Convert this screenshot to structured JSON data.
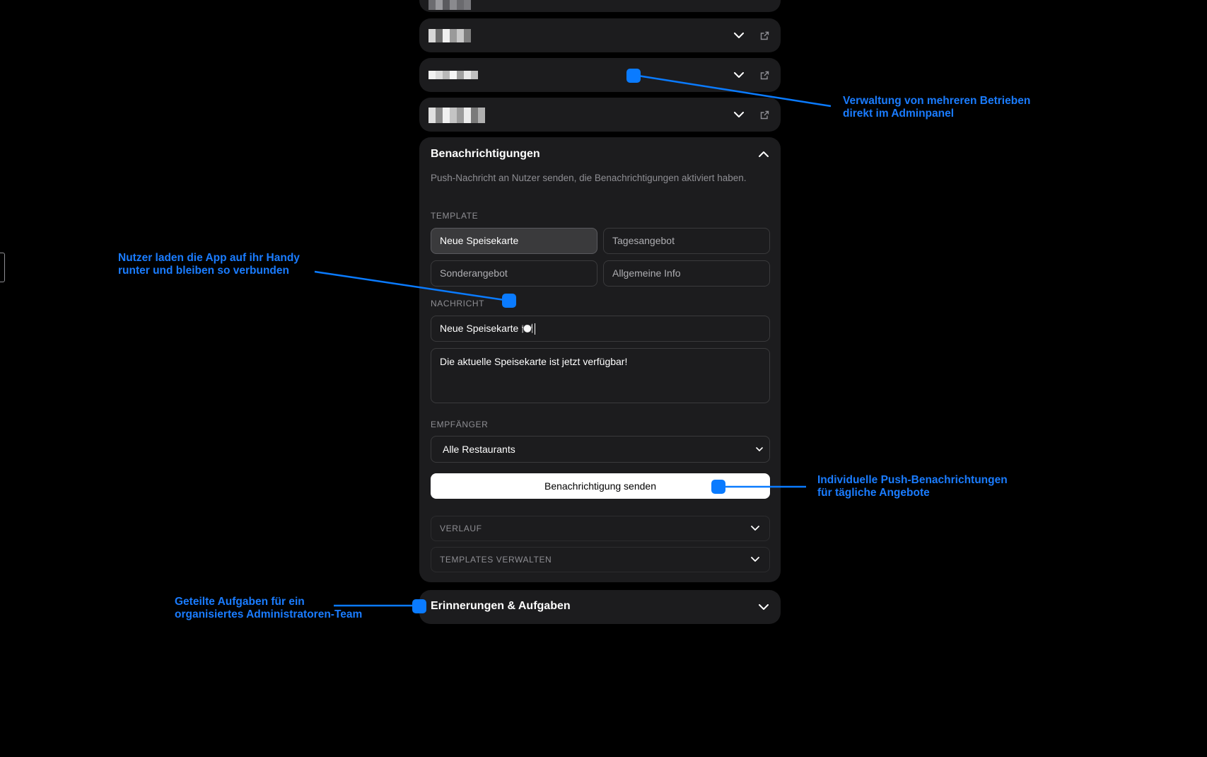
{
  "colors": {
    "background": "#000000",
    "card": "#1c1c1e",
    "accent": "#0a7bff",
    "muted_text": "#8e8e93"
  },
  "restaurant_rows": [
    {
      "icons": [
        "chevron-down-icon",
        "external-link-icon"
      ]
    },
    {
      "icons": [
        "chevron-down-icon",
        "external-link-icon"
      ]
    },
    {
      "icons": [
        "chevron-down-icon",
        "external-link-icon"
      ]
    }
  ],
  "notifications": {
    "title": "Benachrichtigungen",
    "description": "Push-Nachricht an Nutzer senden, die Benachrichtigungen aktiviert haben.",
    "template_label": "TEMPLATE",
    "templates": [
      "Neue Speisekarte",
      "Tagesangebot",
      "Sonderangebot",
      "Allgemeine Info"
    ],
    "selected_template": "Neue Speisekarte",
    "message_label": "NACHRICHT",
    "message_title_value": "Neue Speisekarte 🍽️",
    "message_body_value": "Die aktuelle Speisekarte ist jetzt verfügbar!",
    "recipient_label": "EMPFÄNGER",
    "recipient_value": "Alle Restaurants",
    "send_button": "Benachrichtigung senden",
    "history_label": "VERLAUF",
    "manage_templates_label": "TEMPLATES VERWALTEN"
  },
  "reminders": {
    "title": "Erinnerungen & Aufgaben"
  },
  "annotations": {
    "multi_business": [
      "Verwaltung von mehreren Betrieben",
      "direkt im Adminpanel"
    ],
    "app_download": [
      "Nutzer laden die App auf ihr Handy",
      "runter und bleiben so verbunden"
    ],
    "push": [
      "Individuelle Push-Benachrichtungen",
      "für tägliche Angebote"
    ],
    "tasks": [
      "Geteilte Aufgaben für ein",
      "organisiertes Administratoren-Team"
    ]
  }
}
